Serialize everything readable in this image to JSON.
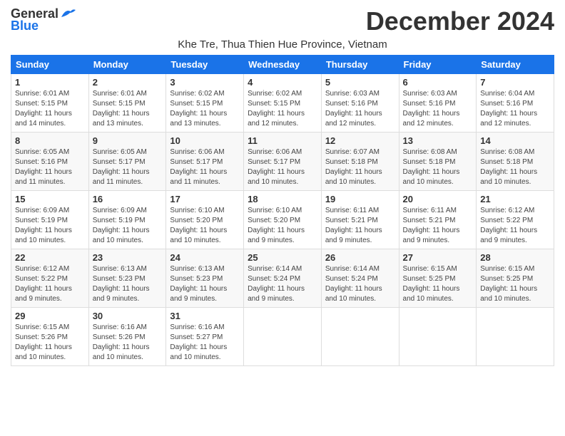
{
  "logo": {
    "general": "General",
    "blue": "Blue"
  },
  "title": "December 2024",
  "location": "Khe Tre, Thua Thien Hue Province, Vietnam",
  "headers": [
    "Sunday",
    "Monday",
    "Tuesday",
    "Wednesday",
    "Thursday",
    "Friday",
    "Saturday"
  ],
  "weeks": [
    [
      {
        "day": "1",
        "sunrise": "6:01 AM",
        "sunset": "5:15 PM",
        "daylight": "11 hours and 14 minutes."
      },
      {
        "day": "2",
        "sunrise": "6:01 AM",
        "sunset": "5:15 PM",
        "daylight": "11 hours and 13 minutes."
      },
      {
        "day": "3",
        "sunrise": "6:02 AM",
        "sunset": "5:15 PM",
        "daylight": "11 hours and 13 minutes."
      },
      {
        "day": "4",
        "sunrise": "6:02 AM",
        "sunset": "5:15 PM",
        "daylight": "11 hours and 12 minutes."
      },
      {
        "day": "5",
        "sunrise": "6:03 AM",
        "sunset": "5:16 PM",
        "daylight": "11 hours and 12 minutes."
      },
      {
        "day": "6",
        "sunrise": "6:03 AM",
        "sunset": "5:16 PM",
        "daylight": "11 hours and 12 minutes."
      },
      {
        "day": "7",
        "sunrise": "6:04 AM",
        "sunset": "5:16 PM",
        "daylight": "11 hours and 12 minutes."
      }
    ],
    [
      {
        "day": "8",
        "sunrise": "6:05 AM",
        "sunset": "5:16 PM",
        "daylight": "11 hours and 11 minutes."
      },
      {
        "day": "9",
        "sunrise": "6:05 AM",
        "sunset": "5:17 PM",
        "daylight": "11 hours and 11 minutes."
      },
      {
        "day": "10",
        "sunrise": "6:06 AM",
        "sunset": "5:17 PM",
        "daylight": "11 hours and 11 minutes."
      },
      {
        "day": "11",
        "sunrise": "6:06 AM",
        "sunset": "5:17 PM",
        "daylight": "11 hours and 10 minutes."
      },
      {
        "day": "12",
        "sunrise": "6:07 AM",
        "sunset": "5:18 PM",
        "daylight": "11 hours and 10 minutes."
      },
      {
        "day": "13",
        "sunrise": "6:08 AM",
        "sunset": "5:18 PM",
        "daylight": "11 hours and 10 minutes."
      },
      {
        "day": "14",
        "sunrise": "6:08 AM",
        "sunset": "5:18 PM",
        "daylight": "11 hours and 10 minutes."
      }
    ],
    [
      {
        "day": "15",
        "sunrise": "6:09 AM",
        "sunset": "5:19 PM",
        "daylight": "11 hours and 10 minutes."
      },
      {
        "day": "16",
        "sunrise": "6:09 AM",
        "sunset": "5:19 PM",
        "daylight": "11 hours and 10 minutes."
      },
      {
        "day": "17",
        "sunrise": "6:10 AM",
        "sunset": "5:20 PM",
        "daylight": "11 hours and 10 minutes."
      },
      {
        "day": "18",
        "sunrise": "6:10 AM",
        "sunset": "5:20 PM",
        "daylight": "11 hours and 9 minutes."
      },
      {
        "day": "19",
        "sunrise": "6:11 AM",
        "sunset": "5:21 PM",
        "daylight": "11 hours and 9 minutes."
      },
      {
        "day": "20",
        "sunrise": "6:11 AM",
        "sunset": "5:21 PM",
        "daylight": "11 hours and 9 minutes."
      },
      {
        "day": "21",
        "sunrise": "6:12 AM",
        "sunset": "5:22 PM",
        "daylight": "11 hours and 9 minutes."
      }
    ],
    [
      {
        "day": "22",
        "sunrise": "6:12 AM",
        "sunset": "5:22 PM",
        "daylight": "11 hours and 9 minutes."
      },
      {
        "day": "23",
        "sunrise": "6:13 AM",
        "sunset": "5:23 PM",
        "daylight": "11 hours and 9 minutes."
      },
      {
        "day": "24",
        "sunrise": "6:13 AM",
        "sunset": "5:23 PM",
        "daylight": "11 hours and 9 minutes."
      },
      {
        "day": "25",
        "sunrise": "6:14 AM",
        "sunset": "5:24 PM",
        "daylight": "11 hours and 9 minutes."
      },
      {
        "day": "26",
        "sunrise": "6:14 AM",
        "sunset": "5:24 PM",
        "daylight": "11 hours and 10 minutes."
      },
      {
        "day": "27",
        "sunrise": "6:15 AM",
        "sunset": "5:25 PM",
        "daylight": "11 hours and 10 minutes."
      },
      {
        "day": "28",
        "sunrise": "6:15 AM",
        "sunset": "5:25 PM",
        "daylight": "11 hours and 10 minutes."
      }
    ],
    [
      {
        "day": "29",
        "sunrise": "6:15 AM",
        "sunset": "5:26 PM",
        "daylight": "11 hours and 10 minutes."
      },
      {
        "day": "30",
        "sunrise": "6:16 AM",
        "sunset": "5:26 PM",
        "daylight": "11 hours and 10 minutes."
      },
      {
        "day": "31",
        "sunrise": "6:16 AM",
        "sunset": "5:27 PM",
        "daylight": "11 hours and 10 minutes."
      },
      null,
      null,
      null,
      null
    ]
  ],
  "labels": {
    "sunrise_prefix": "Sunrise: ",
    "sunset_prefix": "Sunset: ",
    "daylight_prefix": "Daylight: "
  }
}
